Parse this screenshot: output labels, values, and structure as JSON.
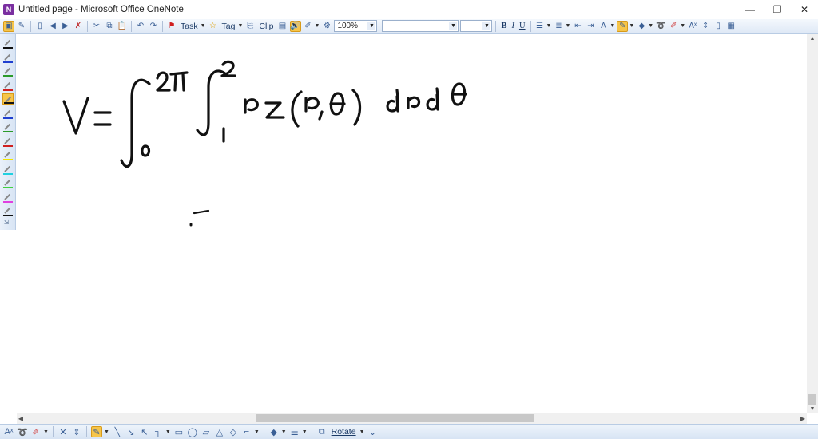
{
  "window": {
    "title": "Untitled page - Microsoft Office OneNote",
    "minimize": "—",
    "restore": "❐",
    "close": "✕"
  },
  "toolbar": {
    "task_label": "Task",
    "tag_label": "Tag",
    "clip_label": "Clip",
    "zoom_value": "100%",
    "font_name": "",
    "font_size": "",
    "bold_label": "B",
    "italic_label": "I",
    "underline_label": "U"
  },
  "pen_palette": [
    {
      "name": "black",
      "color": "#111111"
    },
    {
      "name": "blue",
      "color": "#1f3fd0"
    },
    {
      "name": "green",
      "color": "#2a9a2a"
    },
    {
      "name": "red",
      "color": "#d02020"
    },
    {
      "name": "black-thick",
      "color": "#111111",
      "selected": true
    },
    {
      "name": "blue-thick",
      "color": "#1f3fd0"
    },
    {
      "name": "green-thick",
      "color": "#2a9a2a"
    },
    {
      "name": "red-thick",
      "color": "#d02020"
    },
    {
      "name": "yellow-highlighter",
      "color": "#f2e600"
    },
    {
      "name": "cyan-highlighter",
      "color": "#20d0e0"
    },
    {
      "name": "green-highlighter",
      "color": "#40d040"
    },
    {
      "name": "magenta-highlighter",
      "color": "#e040e0"
    },
    {
      "name": "black-fine",
      "color": "#111111"
    }
  ],
  "bottom_toolbar": {
    "rotate_label": "Rotate"
  },
  "colors": {
    "accent": "#f6c54a",
    "toolbar_bg": "#dfe9f6",
    "ink": "#111111"
  }
}
